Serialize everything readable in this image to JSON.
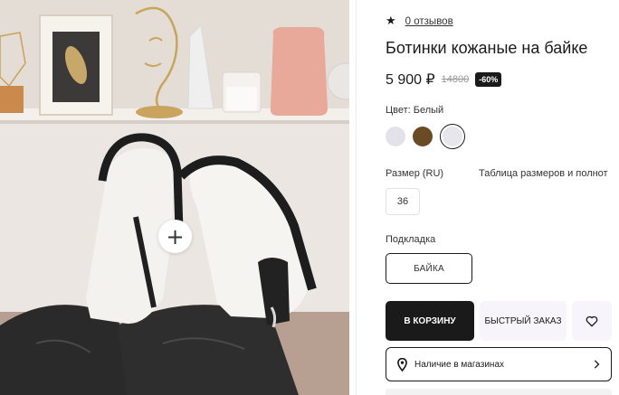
{
  "product": {
    "rating_star": "★",
    "reviews_link": "0 отзывов",
    "title": "Ботинки кожаные на байке",
    "price": "5 900 ₽",
    "old_price": "14800",
    "discount_badge": "-60%"
  },
  "color": {
    "label": "Цвет: Белый",
    "swatches": [
      {
        "name": "Светло-серый",
        "hex": "#e3e2ea"
      },
      {
        "name": "Коричневый",
        "hex": "#6b4a26"
      },
      {
        "name": "Белый",
        "hex": "#e6e6ec",
        "selected": true
      }
    ]
  },
  "size": {
    "label": "Размер (RU)",
    "table_link": "Таблица размеров и полнот",
    "options": [
      "36"
    ]
  },
  "lining": {
    "label": "Подкладка",
    "option": "БАЙКА"
  },
  "actions": {
    "cart_label": "В КОРЗИНУ",
    "quick_order_label": "БЫСТРЫЙ ЗАКАЗ",
    "store_availability_label": "Наличие в магазинах"
  },
  "gallery": {
    "zoom_symbol": "+"
  },
  "icons": {
    "star": "star-icon",
    "heart": "heart-icon",
    "pin": "location-pin-icon",
    "chevron": "chevron-right-icon",
    "zoom": "plus-icon"
  },
  "colors": {
    "primary": "#1a1a1a",
    "button_soft_bg": "#f7f4fb"
  }
}
